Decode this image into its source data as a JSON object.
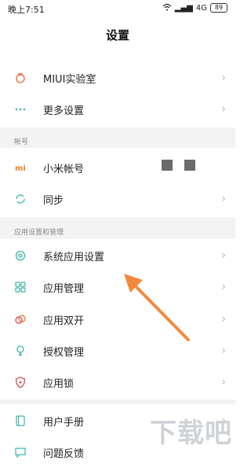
{
  "status_bar": {
    "time": "晚上7:51",
    "network": "4G",
    "battery": "89"
  },
  "page": {
    "title": "设置"
  },
  "sections": {
    "top": [
      {
        "label": "MIUI实验室",
        "icon": "pot-icon"
      },
      {
        "label": "更多设置",
        "icon": "more-dots-icon"
      }
    ],
    "account": {
      "header": "帐号",
      "items": [
        {
          "label": "小米帐号",
          "icon": "mi-logo-icon"
        },
        {
          "label": "同步",
          "icon": "sync-icon"
        }
      ]
    },
    "apps": {
      "header": "应用设置和管理",
      "items": [
        {
          "label": "系统应用设置",
          "icon": "gear-icon"
        },
        {
          "label": "应用管理",
          "icon": "app-grid-icon"
        },
        {
          "label": "应用双开",
          "icon": "dual-app-icon"
        },
        {
          "label": "授权管理",
          "icon": "permission-icon"
        },
        {
          "label": "应用锁",
          "icon": "shield-lock-icon"
        }
      ]
    },
    "bottom": [
      {
        "label": "用户手册",
        "icon": "manual-icon"
      },
      {
        "label": "问题反馈",
        "icon": "feedback-icon"
      }
    ]
  },
  "watermark": "下载吧",
  "colors": {
    "arrow": "#f28a3c",
    "icon_orange": "#e8662e",
    "icon_teal": "#3ab5a8",
    "icon_red": "#d83a3a"
  }
}
